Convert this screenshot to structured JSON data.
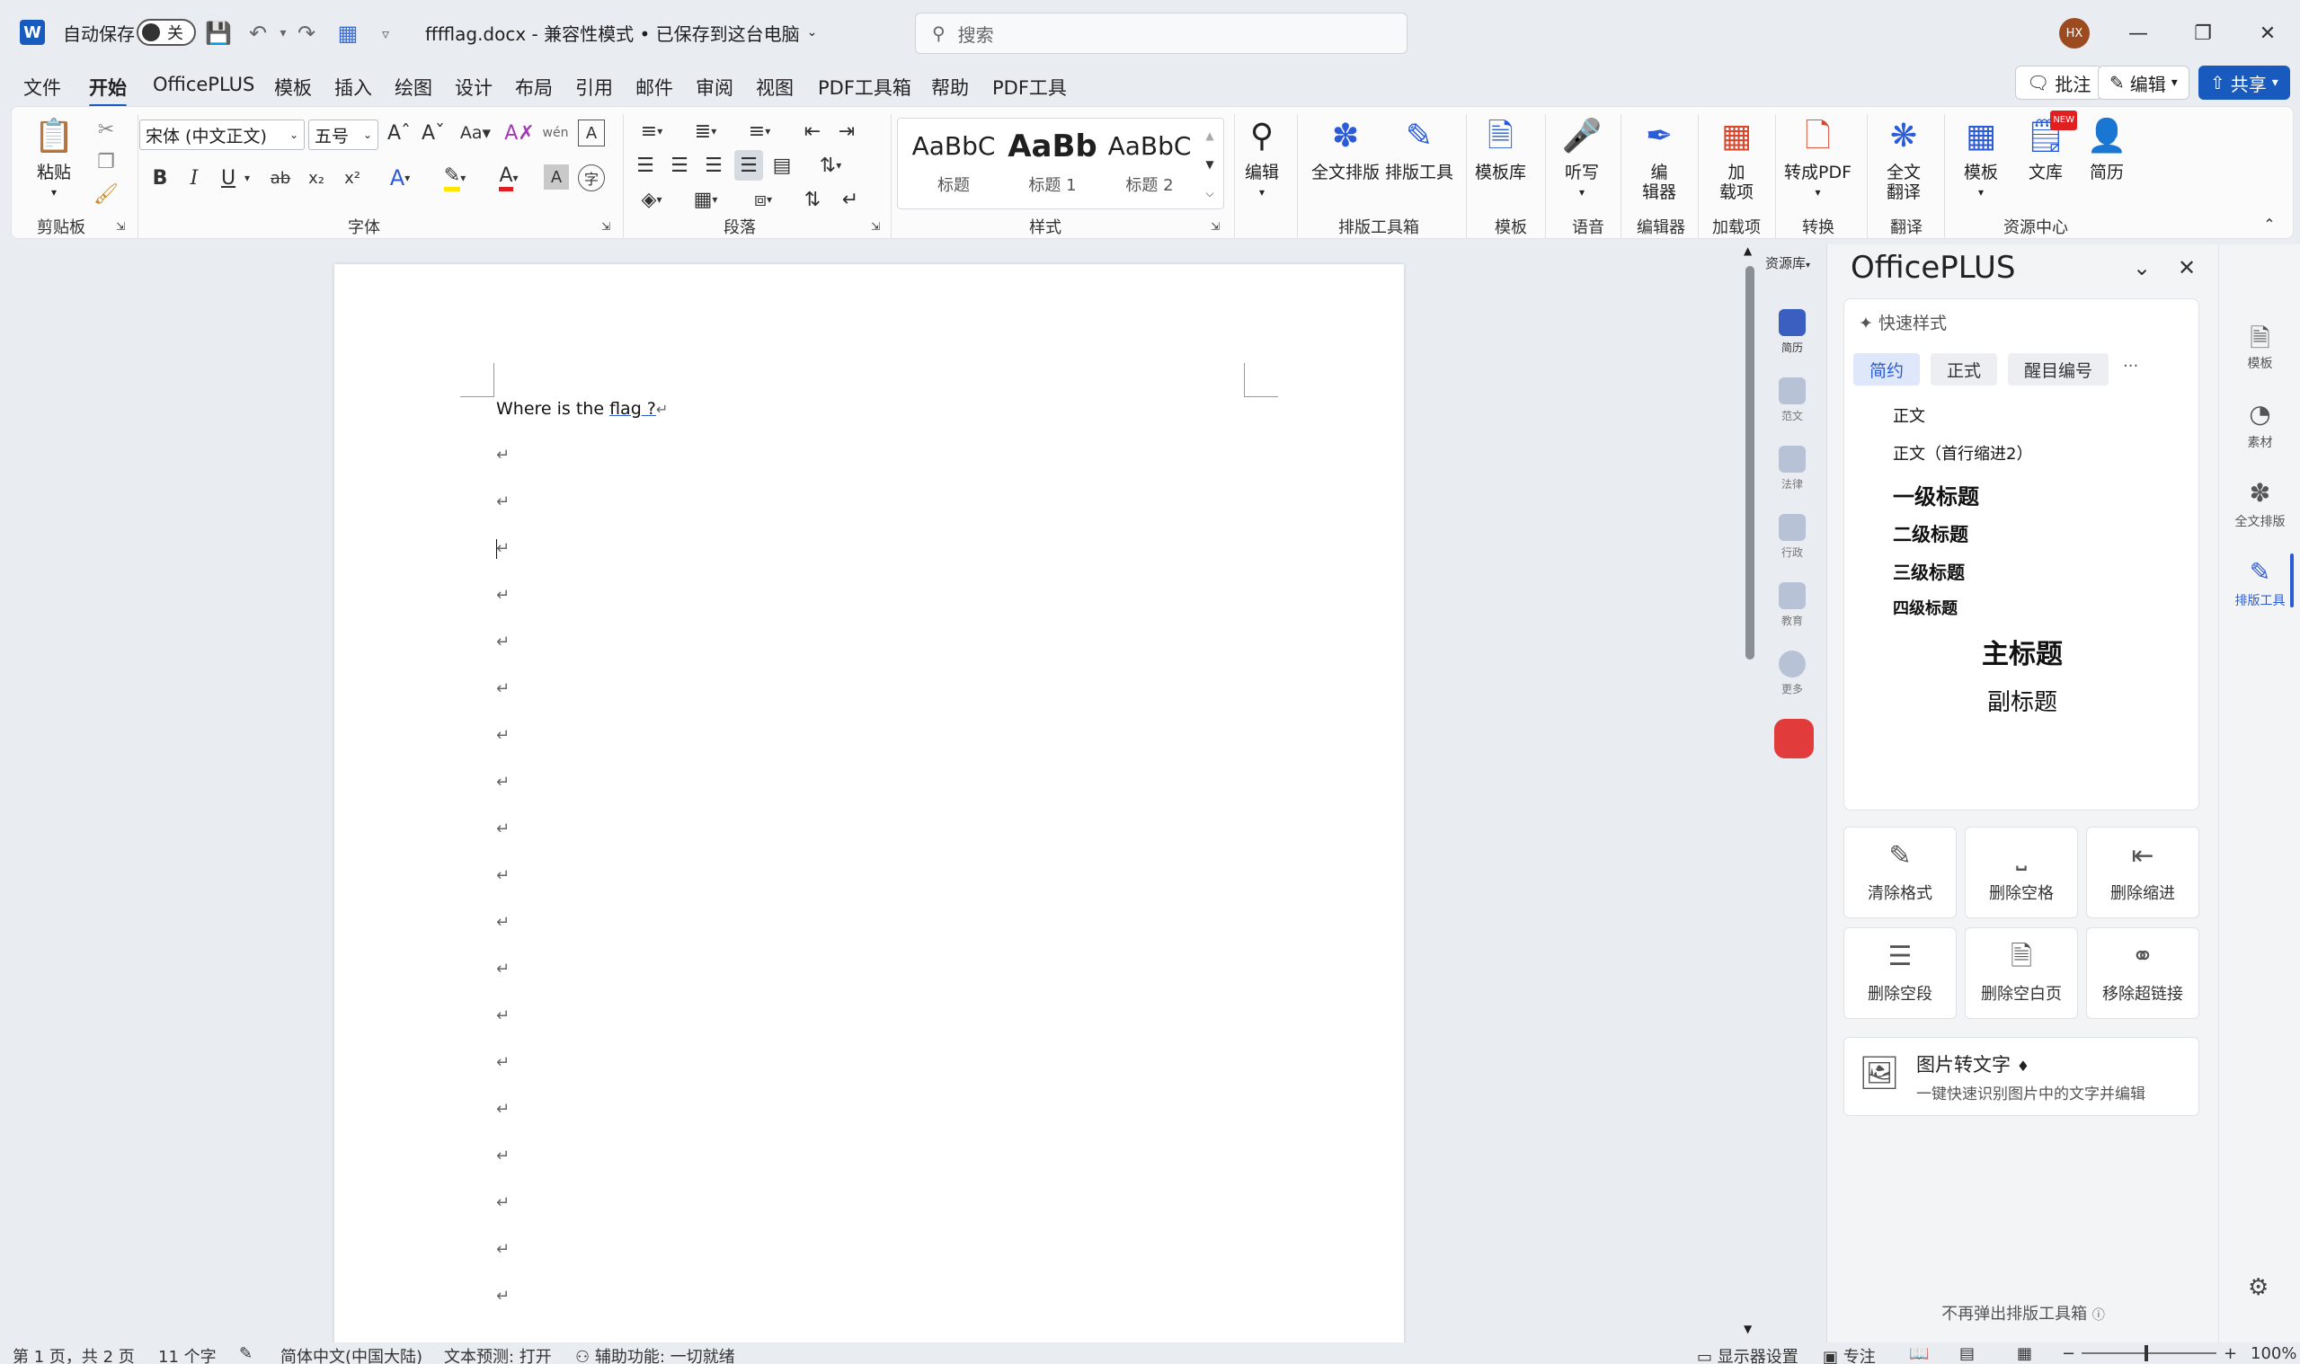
{
  "titlebar": {
    "app_icon": "W",
    "autosave_label": "自动保存",
    "autosave_state": "关",
    "doc_title": "fffflag.docx  -  兼容性模式 • 已保存到这台电脑",
    "search_placeholder": "搜索",
    "user_initials": "HX"
  },
  "menu": {
    "tabs": [
      "文件",
      "开始",
      "OfficePLUS",
      "模板",
      "插入",
      "绘图",
      "设计",
      "布局",
      "引用",
      "邮件",
      "审阅",
      "视图",
      "PDF工具箱",
      "帮助",
      "PDF工具"
    ],
    "active_tab": "开始",
    "comment_label": "批注",
    "edit_label": "编辑",
    "share_label": "共享"
  },
  "ribbon": {
    "clipboard": {
      "paste_label": "粘贴",
      "group_label": "剪贴板"
    },
    "font": {
      "font_name": "宋体 (中文正文)",
      "font_size": "五号",
      "group_label": "字体",
      "buttons": [
        "B",
        "I",
        "U",
        "ab",
        "x₂",
        "x²"
      ]
    },
    "paragraph": {
      "group_label": "段落"
    },
    "styles": {
      "group_label": "样式",
      "items": [
        {
          "sample": "AaBbC",
          "name": "标题"
        },
        {
          "sample": "AaBb",
          "name": "标题 1"
        },
        {
          "sample": "AaBbC",
          "name": "标题 2"
        }
      ]
    },
    "edit_label": "编辑",
    "typeset": {
      "full_label": "全文排版",
      "tool_label": "排版工具",
      "group_label": "排版工具箱"
    },
    "template": {
      "label": "模板库",
      "group_label": "模板"
    },
    "voice": {
      "label": "听写",
      "group_label": "语音"
    },
    "editor": {
      "label": "编\n辑器",
      "group_label": "编辑器"
    },
    "addins": {
      "label": "加\n载项",
      "group_label": "加载项"
    },
    "convert": {
      "label": "转成PDF",
      "group_label": "转换"
    },
    "translate": {
      "label": "全文\n翻译",
      "group_label": "翻译"
    },
    "resource": {
      "template_label": "模板",
      "library_label": "文库",
      "resume_label": "简历",
      "group_label": "资源中心",
      "new_badge": "NEW"
    }
  },
  "document": {
    "first_line_prefix": "Where is the ",
    "first_line_link": "flag ?",
    "para_mark": "↵",
    "empty_paragraphs": 19
  },
  "resource_strip": {
    "title": "资源库",
    "items": [
      "简历",
      "范文",
      "法律",
      "行政",
      "教育",
      "更多"
    ]
  },
  "pane": {
    "title": "OfficePLUS",
    "quick_style_label": "快速样式",
    "chips": [
      "简约",
      "正式",
      "醒目编号"
    ],
    "more": "···",
    "styles": [
      "正文",
      "正文（首行缩进2）",
      "一级标题",
      "二级标题",
      "三级标题",
      "四级标题",
      "主标题",
      "副标题"
    ],
    "tools": [
      "清除格式",
      "删除空格",
      "删除缩进",
      "删除空段",
      "删除空白页",
      "移除超链接"
    ],
    "ocr_title": "图片转文字",
    "ocr_desc": "一键快速识别图片中的文字并编辑",
    "footer": "不再弹出排版工具箱"
  },
  "rail": {
    "items": [
      "模板",
      "素材",
      "全文排版",
      "排版工具"
    ],
    "active": "排版工具"
  },
  "statusbar": {
    "page": "第 1 页，共 2 页",
    "words": "11 个字",
    "language": "简体中文(中国大陆)",
    "prediction": "文本预测: 打开",
    "accessibility": "辅助功能: 一切就绪",
    "display_settings": "显示器设置",
    "focus": "专注",
    "zoom": "100%"
  },
  "colors": {
    "accent": "#185abd",
    "pane_accent": "#2b5bd7",
    "background": "#e9edf2"
  }
}
